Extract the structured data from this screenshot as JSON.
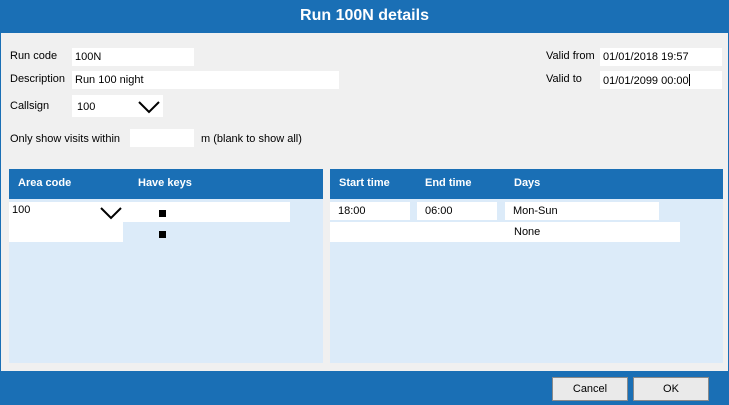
{
  "dialog": {
    "title": "Run 100N details"
  },
  "form": {
    "run_code_label": "Run code",
    "run_code_value": "100N",
    "description_label": "Description",
    "description_value": "Run 100 night",
    "callsign_label": "Callsign",
    "callsign_value": "100",
    "valid_from_label": "Valid from",
    "valid_from_value": "01/01/2018 19:57",
    "valid_to_label": "Valid to",
    "valid_to_value": "01/01/2099 00:00",
    "visits_label": "Only show visits within",
    "visits_value": "",
    "visits_suffix": "m (blank to show all)"
  },
  "area_table": {
    "headers": [
      "Area code",
      "Have keys"
    ],
    "rows": [
      {
        "area_code": "100",
        "have_keys": true
      },
      {
        "area_code": "",
        "have_keys": true
      }
    ]
  },
  "time_table": {
    "headers": [
      "Start time",
      "End time",
      "Days"
    ],
    "rows": [
      {
        "start": "18:00",
        "end": "06:00",
        "days": "Mon-Sun"
      },
      {
        "start": "",
        "end": "",
        "days": "None"
      }
    ]
  },
  "footer": {
    "cancel_label": "Cancel",
    "ok_label": "OK"
  },
  "icons": {
    "dropdown": "chevron-down-icon",
    "checkbox": "checkbox-checked-icon"
  },
  "colors": {
    "accent": "#1a6fb5",
    "panel_bg": "#dcebf9",
    "window_bg": "#f0f0f0"
  }
}
